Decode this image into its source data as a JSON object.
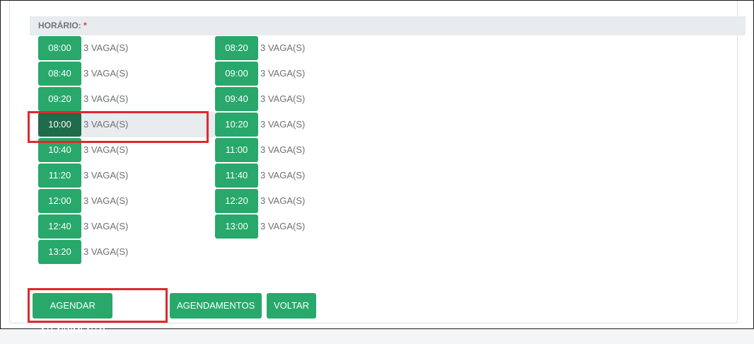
{
  "form": {
    "label": "HORÁRIO:",
    "required_mark": "*",
    "slots_left": [
      {
        "time": "08:00",
        "availability": "3 VAGA(S)"
      },
      {
        "time": "08:40",
        "availability": "3 VAGA(S)"
      },
      {
        "time": "09:20",
        "availability": "3 VAGA(S)"
      },
      {
        "time": "10:00",
        "availability": "3 VAGA(S)",
        "selected": true
      },
      {
        "time": "10:40",
        "availability": "3 VAGA(S)"
      },
      {
        "time": "11:20",
        "availability": "3 VAGA(S)"
      },
      {
        "time": "12:00",
        "availability": "3 VAGA(S)"
      },
      {
        "time": "12:40",
        "availability": "3 VAGA(S)"
      },
      {
        "time": "13:20",
        "availability": "3 VAGA(S)"
      }
    ],
    "slots_right": [
      {
        "time": "08:20",
        "availability": "3 VAGA(S)"
      },
      {
        "time": "09:00",
        "availability": "3 VAGA(S)"
      },
      {
        "time": "09:40",
        "availability": "3 VAGA(S)"
      },
      {
        "time": "10:20",
        "availability": "3 VAGA(S)"
      },
      {
        "time": "11:00",
        "availability": "3 VAGA(S)"
      },
      {
        "time": "11:40",
        "availability": "3 VAGA(S)"
      },
      {
        "time": "12:20",
        "availability": "3 VAGA(S)"
      },
      {
        "time": "13:00",
        "availability": "3 VAGA(S)"
      }
    ]
  },
  "actions": {
    "schedule_label": "AGENDAR ATENDIMENTO",
    "appointments_label": "AGENDAMENTOS",
    "back_label": "VOLTAR"
  },
  "colors": {
    "button_green": "#28a86b",
    "selected_green": "#1f6b4a",
    "highlight_red": "#e0282e",
    "required_red": "#dc3545"
  }
}
